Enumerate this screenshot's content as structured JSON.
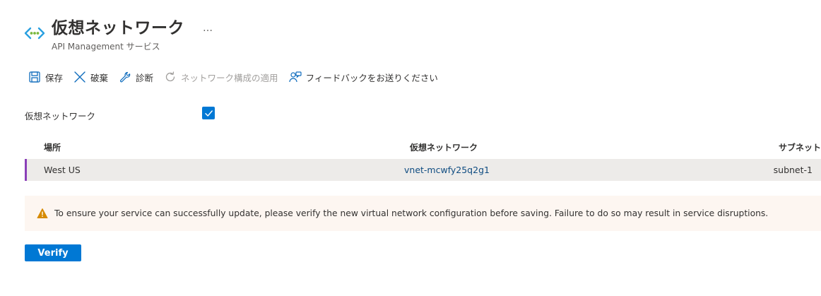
{
  "header": {
    "title": "仮想ネットワーク",
    "subtitle": "API Management サービス",
    "more": "…",
    "icon": "virtual-network-icon"
  },
  "toolbar": {
    "save_label": "保存",
    "discard_label": "破棄",
    "diagnose_label": "診断",
    "apply_label": "ネットワーク構成の適用",
    "feedback_label": "フィードバックをお送りください"
  },
  "form": {
    "vnet_label": "仮想ネットワーク",
    "vnet_checked": true
  },
  "table": {
    "headers": {
      "location": "場所",
      "vnet": "仮想ネットワーク",
      "subnet": "サブネット"
    },
    "rows": [
      {
        "location": "West US",
        "vnet": "vnet-mcwfy25q2g1",
        "subnet": "subnet-1"
      }
    ]
  },
  "warning": {
    "text": "To ensure your service can successfully update, please verify the new virtual network configuration before saving. Failure to do so may result in service disruptions."
  },
  "actions": {
    "verify_label": "Verify"
  },
  "colors": {
    "accent": "#0078d4",
    "row_marker": "#8a3fb8",
    "warning_bg": "#fdf6f1",
    "warning_icon": "#d68a00"
  }
}
